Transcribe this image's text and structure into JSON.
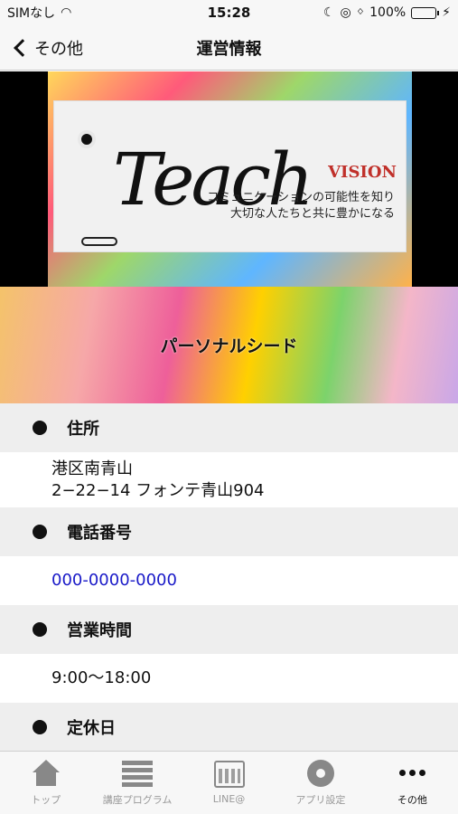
{
  "status": {
    "carrier": "SIMなし",
    "time": "15:28",
    "battery": "100%"
  },
  "nav": {
    "back_label": "その他",
    "title": "運営情報"
  },
  "banner": {
    "headline": "Teach",
    "vision": "VISION",
    "copy_line1": "コミュニケーションの可能性を知り",
    "copy_line2": "大切な人たちと共に豊かになる"
  },
  "section": {
    "title": "パーソナルシード"
  },
  "info": [
    {
      "label": "住所",
      "lines": [
        "港区南青山",
        "2−22−14 フォンテ青山904"
      ]
    },
    {
      "label": "電話番号",
      "value": "000-0000-0000"
    },
    {
      "label": "営業時間",
      "value": "9:00〜18:00"
    },
    {
      "label": "定休日"
    }
  ],
  "tabs": [
    {
      "label": "トップ",
      "icon": "home-icon"
    },
    {
      "label": "講座プログラム",
      "icon": "list-icon"
    },
    {
      "label": "LINE@",
      "icon": "calendar-icon"
    },
    {
      "label": "アプリ設定",
      "icon": "gear-icon"
    },
    {
      "label": "その他",
      "icon": "more-icon",
      "active": true
    }
  ]
}
